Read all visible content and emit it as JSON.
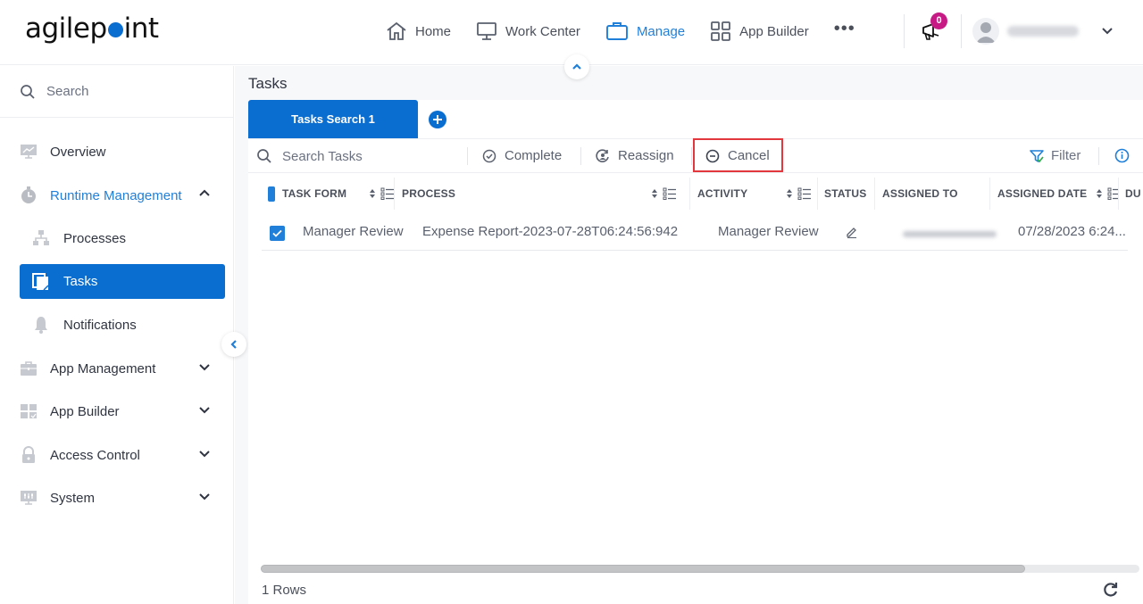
{
  "brand": {
    "logo_pre": "agilep",
    "logo_post": "int",
    "accent": "#0a6ed1"
  },
  "nav": {
    "items": [
      {
        "label": "Home",
        "icon": "home-icon",
        "active": false
      },
      {
        "label": "Work Center",
        "icon": "monitor-icon",
        "active": false
      },
      {
        "label": "Manage",
        "icon": "briefcase-icon",
        "active": true
      },
      {
        "label": "App Builder",
        "icon": "grid-icon",
        "active": false
      }
    ],
    "more_label": "•••",
    "notification_count": "0"
  },
  "sidebar": {
    "search_placeholder": "Search",
    "items": [
      {
        "label": "Overview",
        "icon": "chart-monitor-icon"
      },
      {
        "label": "Runtime Management",
        "icon": "stopwatch-icon",
        "expanded": true
      },
      {
        "label": "Processes",
        "icon": "hierarchy-icon"
      },
      {
        "label": "Tasks",
        "icon": "tasks-icon",
        "active": true
      },
      {
        "label": "Notifications",
        "icon": "bell-icon"
      },
      {
        "label": "App Management",
        "icon": "toolbox-icon"
      },
      {
        "label": "App Builder",
        "icon": "app-builder-icon"
      },
      {
        "label": "Access Control",
        "icon": "lock-icon"
      },
      {
        "label": "System",
        "icon": "system-icon"
      }
    ]
  },
  "main": {
    "title": "Tasks",
    "tabs": [
      {
        "label": "Tasks Search 1",
        "active": true
      }
    ],
    "toolbar": {
      "search_placeholder": "Search Tasks",
      "complete_label": "Complete",
      "reassign_label": "Reassign",
      "cancel_label": "Cancel",
      "filter_label": "Filter"
    },
    "columns": [
      "TASK FORM",
      "PROCESS",
      "ACTIVITY",
      "STATUS",
      "ASSIGNED TO",
      "ASSIGNED DATE",
      "DU"
    ],
    "rows": [
      {
        "checked": true,
        "task_form": "Manager Review",
        "process": "Expense Report-2023-07-28T06:24:56:942",
        "activity": "Manager Review",
        "status_icon": "edit-icon",
        "assigned_to": "",
        "assigned_date": "07/28/2023 6:24..."
      }
    ],
    "rows_count_label": "1 Rows",
    "horizontal_scroll_fraction": 0.87
  }
}
